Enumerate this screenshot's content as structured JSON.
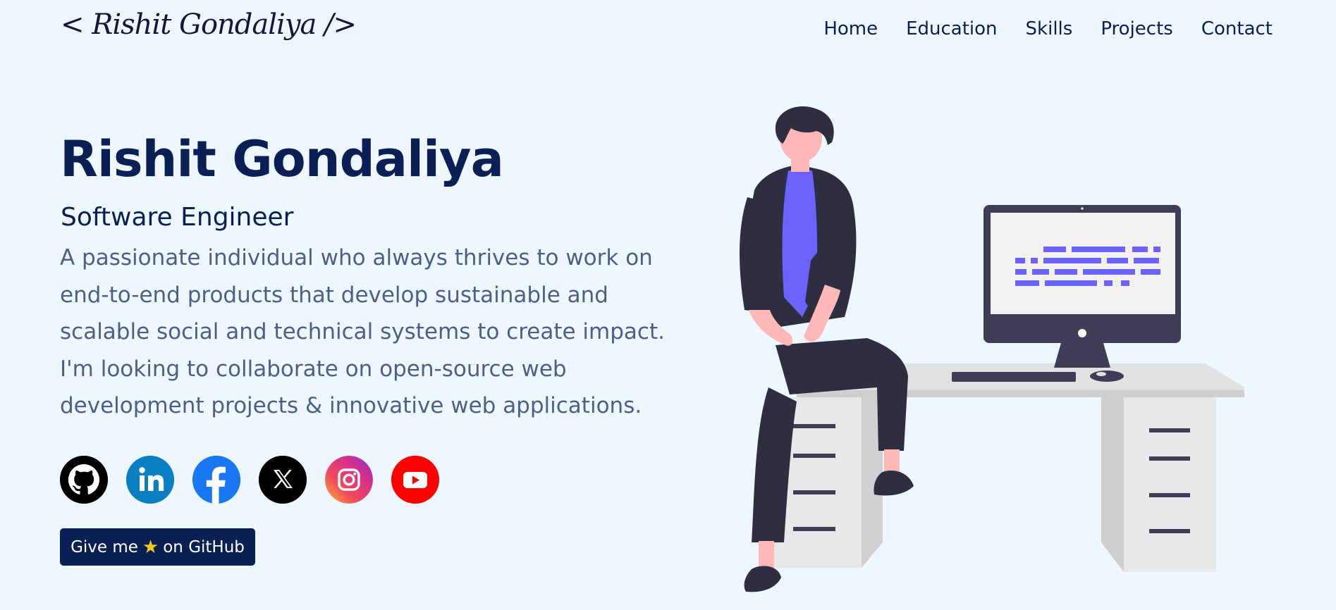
{
  "header": {
    "logo": "< Rishit Gondaliya />",
    "nav": [
      "Home",
      "Education",
      "Skills",
      "Projects",
      "Contact"
    ]
  },
  "hero": {
    "name": "Rishit Gondaliya",
    "role": "Software Engineer",
    "description": "A passionate individual who always thrives to work on end-to-end products that develop sustainable and scalable social and technical systems to create impact. I'm looking to collaborate on open-source web development projects & innovative web applications."
  },
  "socials": [
    {
      "icon": "github-icon",
      "color": "#000000"
    },
    {
      "icon": "linkedin-icon",
      "color": "#0a80c2"
    },
    {
      "icon": "facebook-icon",
      "color": "#1877f2"
    },
    {
      "icon": "x-twitter-icon",
      "color": "#000000"
    },
    {
      "icon": "instagram-icon",
      "color": "#e1306c"
    },
    {
      "icon": "youtube-icon",
      "color": "#ff0000"
    }
  ],
  "cta": {
    "label_before": "Give me",
    "label_after": "on GitHub",
    "star_icon": "star-icon"
  },
  "colors": {
    "background": "#edf7fd",
    "primary": "#0a1f54",
    "text_muted": "#4d5f86",
    "accent": "#6c63ff"
  }
}
